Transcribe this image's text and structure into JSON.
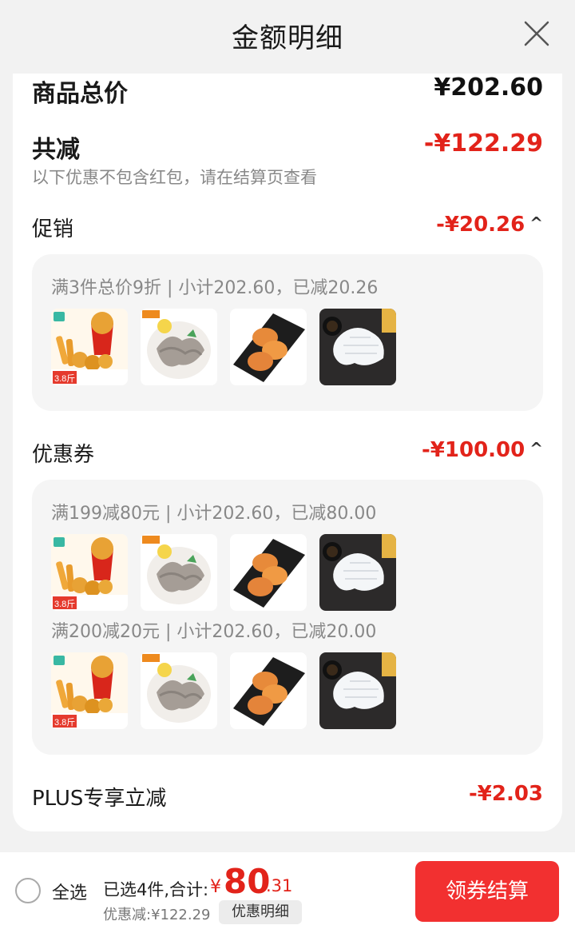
{
  "header": {
    "title": "金额明细"
  },
  "summary": {
    "total_label": "商品总价",
    "total_value": "¥202.60",
    "reduce_label": "共减",
    "reduce_value": "-¥122.29",
    "hint": "以下优惠不包含红包，请在结算页查看"
  },
  "promotion": {
    "label": "促销",
    "value": "-¥20.26",
    "chevron": "^",
    "rule": "满3件总价9折 | 小计202.60，已减20.26"
  },
  "coupon": {
    "label": "优惠券",
    "value": "-¥100.00",
    "chevron": "^",
    "rules": [
      "满199减80元 | 小计202.60，已减80.00",
      "满200减20元 | 小计202.60，已减20.00"
    ]
  },
  "plus": {
    "label": "PLUS专享立减",
    "value": "-¥2.03"
  },
  "products": [
    {
      "name": "fried-chicken",
      "tag": "3.8斤"
    },
    {
      "name": "octopus"
    },
    {
      "name": "chicken-wings"
    },
    {
      "name": "squid"
    }
  ],
  "footer": {
    "select_all": "全选",
    "selected": "已选4件,合计:",
    "currency": "¥",
    "total_int": "80",
    "total_dec": ".31",
    "discount": "优惠减:¥122.29",
    "detail_button": "优惠明细",
    "checkout_button": "领券结算"
  },
  "colors": {
    "accent": "#e2231a",
    "button": "#f23030"
  }
}
